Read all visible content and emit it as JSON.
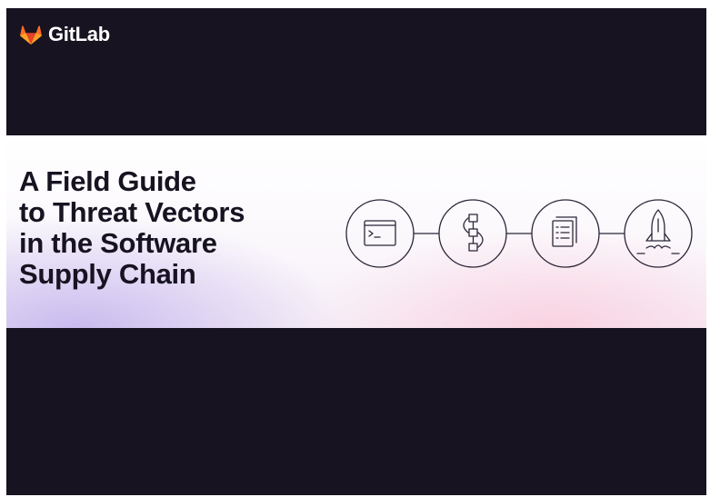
{
  "brand": {
    "name": "GitLab",
    "logo_icon": "gitlab-tanuki-icon",
    "logo_color": "#FC6D26"
  },
  "cover": {
    "title_lines": [
      "A Field Guide",
      "to Threat Vectors",
      "in the Software",
      "Supply Chain"
    ],
    "background_color": "#171321"
  },
  "pipeline": {
    "stages": [
      {
        "icon": "terminal-icon"
      },
      {
        "icon": "build-flow-icon"
      },
      {
        "icon": "package-icon"
      },
      {
        "icon": "rocket-launch-icon"
      }
    ]
  }
}
